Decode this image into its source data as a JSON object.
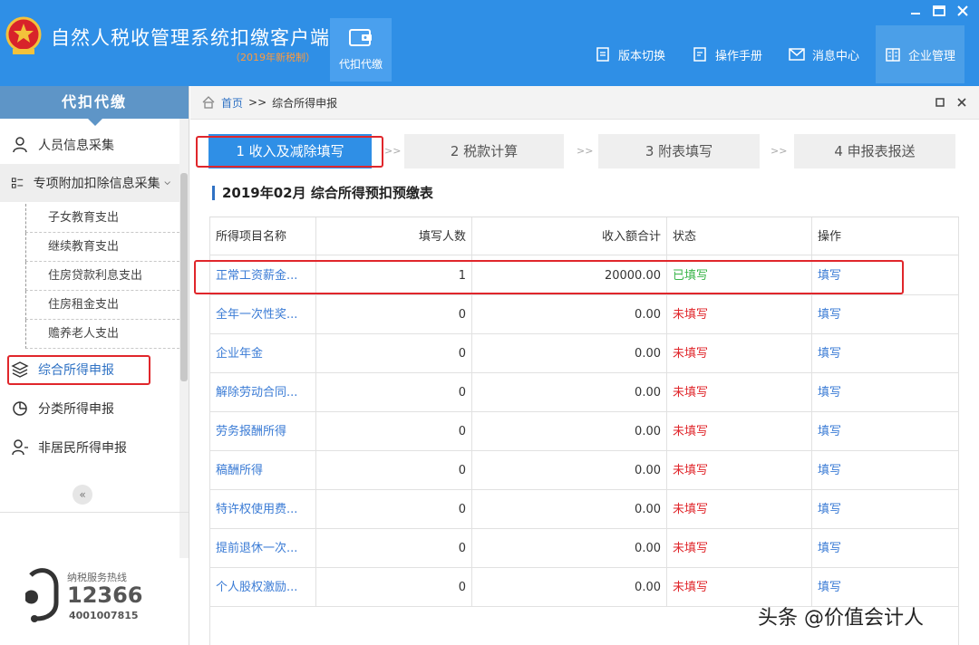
{
  "header": {
    "app_title": "自然人税收管理系统扣缴客户端",
    "app_version": "（2019年新税制）",
    "module_tab": "代扣代缴",
    "nav": {
      "version_switch": "版本切换",
      "manual": "操作手册",
      "messages": "消息中心",
      "enterprise": "企业管理"
    },
    "colors": {
      "primary": "#2f8fe6",
      "accent_red": "#e0262b",
      "ok_green": "#3ab54a"
    }
  },
  "sidebar": {
    "title": "代扣代缴",
    "items": [
      {
        "label": "人员信息采集",
        "icon": "person-icon"
      },
      {
        "label": "专项附加扣除信息采集",
        "icon": "grid-list-icon"
      },
      {
        "label": "综合所得申报",
        "icon": "layers-icon"
      },
      {
        "label": "分类所得申报",
        "icon": "pie-icon"
      },
      {
        "label": "非居民所得申报",
        "icon": "person-plus-icon"
      }
    ],
    "sub_items": [
      "子女教育支出",
      "继续教育支出",
      "住房贷款利息支出",
      "住房租金支出",
      "赡养老人支出"
    ],
    "collapse": "«",
    "hotline": {
      "label": "纳税服务热线",
      "number": "12366",
      "sub": "4001007815"
    }
  },
  "breadcrumb": {
    "home": "首页",
    "sep": ">>",
    "current": "综合所得申报"
  },
  "steps": [
    {
      "label": "1 收入及减除填写"
    },
    {
      "label": "2 税款计算"
    },
    {
      "label": "3 附表填写"
    },
    {
      "label": "4 申报表报送"
    }
  ],
  "step_arrow": ">>",
  "section": {
    "title": "2019年02月  综合所得预扣预缴表"
  },
  "table": {
    "headers": [
      "所得项目名称",
      "填写人数",
      "收入额合计",
      "状态",
      "操作"
    ],
    "rows": [
      {
        "name": "正常工资薪金...",
        "count": "1",
        "amount": "20000.00",
        "status": "已填写",
        "action": "填写"
      },
      {
        "name": "全年一次性奖...",
        "count": "0",
        "amount": "0.00",
        "status": "未填写",
        "action": "填写"
      },
      {
        "name": "企业年金",
        "count": "0",
        "amount": "0.00",
        "status": "未填写",
        "action": "填写"
      },
      {
        "name": "解除劳动合同...",
        "count": "0",
        "amount": "0.00",
        "status": "未填写",
        "action": "填写"
      },
      {
        "name": "劳务报酬所得",
        "count": "0",
        "amount": "0.00",
        "status": "未填写",
        "action": "填写"
      },
      {
        "name": "稿酬所得",
        "count": "0",
        "amount": "0.00",
        "status": "未填写",
        "action": "填写"
      },
      {
        "name": "特许权使用费...",
        "count": "0",
        "amount": "0.00",
        "status": "未填写",
        "action": "填写"
      },
      {
        "name": "提前退休一次...",
        "count": "0",
        "amount": "0.00",
        "status": "未填写",
        "action": "填写"
      },
      {
        "name": "个人股权激励...",
        "count": "0",
        "amount": "0.00",
        "status": "未填写",
        "action": "填写"
      }
    ]
  },
  "watermark": "头条 @价值会计人"
}
